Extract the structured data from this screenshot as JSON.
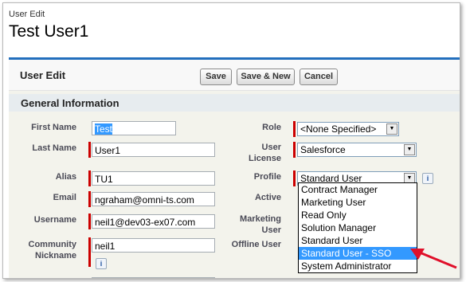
{
  "header": {
    "subtitle": "User Edit",
    "title": "Test User1"
  },
  "panel": {
    "title": "User Edit"
  },
  "buttons": {
    "save": "Save",
    "save_new": "Save & New",
    "cancel": "Cancel"
  },
  "section": {
    "title": "General Information"
  },
  "fields": {
    "first_name": {
      "label": "First Name",
      "value": "Test"
    },
    "last_name": {
      "label": "Last Name",
      "value": "User1"
    },
    "alias": {
      "label": "Alias",
      "value": "TU1"
    },
    "email": {
      "label": "Email",
      "value": "ngraham@omni-ts.com"
    },
    "username": {
      "label": "Username",
      "value": "neil1@dev03-ex07.com"
    },
    "community_nickname": {
      "label_line1": "Community",
      "label_line2": "Nickname",
      "value": "neil1"
    },
    "role": {
      "label": "Role",
      "value": "<None Specified>"
    },
    "user_license": {
      "label_line1": "User",
      "label_line2": "License",
      "value": "Salesforce"
    },
    "profile": {
      "label": "Profile",
      "value": "Standard User"
    },
    "active": {
      "label": "Active"
    },
    "marketing_user": {
      "label_line1": "Marketing",
      "label_line2": "User"
    },
    "offline_user": {
      "label": "Offline User"
    }
  },
  "profile_options": [
    "Contract Manager",
    "Marketing User",
    "Read Only",
    "Solution Manager",
    "Standard User",
    "Standard User - SSO",
    "System Administrator"
  ],
  "colors": {
    "accent": "#236fbd",
    "required": "#cc0000",
    "highlight": "#3399ff",
    "arrow": "#e0102a"
  },
  "icons": {
    "info": "i",
    "dropdown": "▼"
  }
}
